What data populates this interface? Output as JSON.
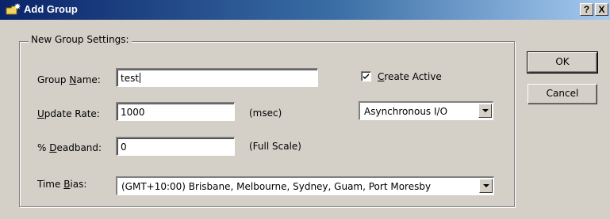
{
  "window": {
    "title": "Add Group",
    "help_label": "?",
    "close_label": "X"
  },
  "group": {
    "legend": "New Group Settings:",
    "name_label_pre": "Group ",
    "name_label_u": "N",
    "name_label_post": "ame:",
    "name_value": "test",
    "update_label_u": "U",
    "update_label_post": "pdate Rate:",
    "update_value": "1000",
    "update_unit": "(msec)",
    "deadband_label_pre": "% ",
    "deadband_label_u": "D",
    "deadband_label_post": "eadband:",
    "deadband_value": "0",
    "deadband_unit": "(Full Scale)",
    "timebias_label_pre": "Time ",
    "timebias_label_u": "B",
    "timebias_label_post": "ias:",
    "timebias_value": "(GMT+10:00) Brisbane, Melbourne, Sydney, Guam, Port Moresby",
    "create_active_u": "C",
    "create_active_post": "reate Active",
    "create_active_checked": true,
    "io_mode_value": "Asynchronous I/O"
  },
  "buttons": {
    "ok_label": "OK",
    "cancel_label": "Cancel"
  }
}
